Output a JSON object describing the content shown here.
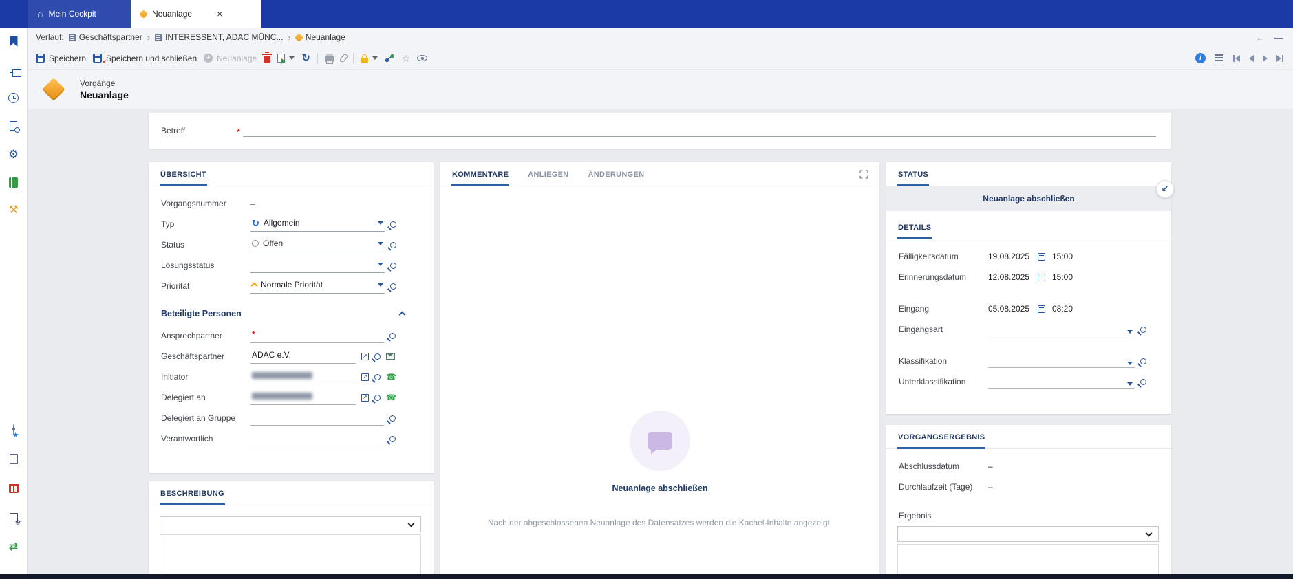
{
  "colors": {
    "topbar": "#1c3aa5",
    "accent": "#2b579a",
    "tab_underline": "#2e5fa3",
    "orange_diamond": "#f2a32c",
    "required": "#e02020",
    "disabled_text": "#b0b6bf"
  },
  "icons": {
    "home": "⌂",
    "close": "×",
    "crumb_sep": "›",
    "back_arrow": "←",
    "minimize": "—",
    "refresh": "↻",
    "circle_arrows": "↻",
    "star_outline": "☆",
    "star_filled": "★",
    "phone": "☎",
    "gear": "⚙",
    "tools": "⚒",
    "sync": "⇄",
    "collapse_arrow": "↙",
    "info": "i",
    "external_arrow": "↗"
  },
  "topbar": {
    "tab_cockpit": "Mein Cockpit",
    "tab_active": "Neuanlage"
  },
  "breadcrumb": {
    "prefix": "Verlauf:",
    "item1": "Geschäftspartner",
    "item2": "INTERESSENT, ADAC MÜNC...",
    "item3": "Neuanlage"
  },
  "toolbar": {
    "save": "Speichern",
    "save_close": "Speichern und schließen",
    "new_record": "Neuanlage"
  },
  "header": {
    "category": "Vorgänge",
    "title": "Neuanlage"
  },
  "sidebar": {
    "icons": [
      "favorites-bookmark",
      "windows-apps",
      "history-clock",
      "search-records",
      "settings-gear",
      "address-book",
      "admin-tools",
      "watch-eye-star",
      "notes-edit",
      "planner-calendar",
      "document-settings",
      "sync-arrows"
    ]
  },
  "betreff": {
    "label": "Betreff",
    "required": "*"
  },
  "overview": {
    "title": "ÜBERSICHT",
    "vorgangsnummer_label": "Vorgangsnummer",
    "vorgangsnummer_value": "–",
    "typ_label": "Typ",
    "typ_value": "Allgemein",
    "status_label": "Status",
    "status_value": "Offen",
    "loesungsstatus_label": "Lösungsstatus",
    "loesungsstatus_value": "",
    "prioritaet_label": "Priorität",
    "prioritaet_value": "Normale Priorität"
  },
  "persons": {
    "title": "Beteiligte Personen",
    "ansprechpartner_label": "Ansprechpartner",
    "required": "*",
    "geschaeftspartner_label": "Geschäftspartner",
    "geschaeftspartner_value": "ADAC e.V.",
    "initiator_label": "Initiator",
    "initiator_value_redacted": true,
    "delegiert_label": "Delegiert an",
    "delegiert_value_redacted": true,
    "gruppe_label": "Delegiert an Gruppe",
    "verantwortlich_label": "Verantwortlich"
  },
  "beschreibung": {
    "title": "BESCHREIBUNG"
  },
  "comments": {
    "tab_kommentare": "KOMMENTARE",
    "tab_anliegen": "ANLIEGEN",
    "tab_aenderungen": "ÄNDERUNGEN",
    "empty_title": "Neuanlage abschließen",
    "empty_text": "Nach der abgeschlossenen Neuanlage des Datensatzes werden die Kachel-Inhalte angezeigt."
  },
  "status_panel": {
    "title": "STATUS",
    "action": "Neuanlage abschließen",
    "details_title": "DETAILS",
    "faelligkeitsdatum_label": "Fälligkeitsdatum",
    "faelligkeitsdatum_date": "19.08.2025",
    "faelligkeitsdatum_time": "15:00",
    "erinnerungsdatum_label": "Erinnerungsdatum",
    "erinnerungsdatum_date": "12.08.2025",
    "erinnerungsdatum_time": "15:00",
    "eingang_label": "Eingang",
    "eingang_date": "05.08.2025",
    "eingang_time": "08:20",
    "eingangsart_label": "Eingangsart",
    "klassifikation_label": "Klassifikation",
    "unterklassifikation_label": "Unterklassifikation"
  },
  "result_panel": {
    "title": "VORGANGSERGEBNIS",
    "abschlussdatum_label": "Abschlussdatum",
    "abschlussdatum_value": "–",
    "durchlaufzeit_label": "Durchlaufzeit (Tage)",
    "durchlaufzeit_value": "–",
    "ergebnis_label": "Ergebnis"
  }
}
